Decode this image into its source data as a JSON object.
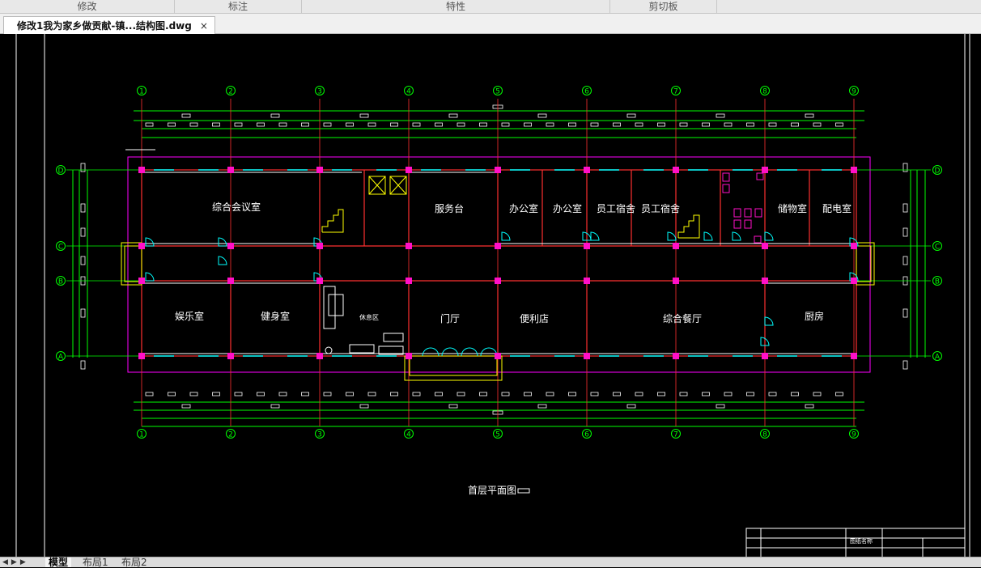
{
  "ribbon": {
    "groups": [
      "修改",
      "标注",
      "特性",
      "剪切板"
    ]
  },
  "document": {
    "tab_title": "修改1我为家乡做贡献-镇...结构图.dwg",
    "close_glyph": "×"
  },
  "drawing": {
    "grid_top": [
      "1",
      "2",
      "3",
      "4",
      "5",
      "6",
      "7",
      "8",
      "9"
    ],
    "grid_side": [
      "D",
      "C",
      "B",
      "A"
    ],
    "rooms": {
      "conference": "综合会议室",
      "service": "服务台",
      "office1": "办公室",
      "office2": "办公室",
      "staff1": "员工宿舍",
      "staff2": "员工宿舍",
      "storage": "储物室",
      "power": "配电室",
      "entertainment": "娱乐室",
      "gym": "健身室",
      "lounge": "休息区",
      "hall": "门厅",
      "store": "便利店",
      "dining": "综合餐厅",
      "kitchen": "厨房"
    },
    "plan_title": "首层平面图",
    "titleblock_text": "图纸名称"
  },
  "layout_tabs": {
    "model": "模型",
    "layout1": "布局1",
    "layout2": "布局2"
  },
  "colors": {
    "wall": "#ff3030",
    "axis": "#00ff00",
    "column": "#ff10c8",
    "window": "#00ffff",
    "text": "#ffffff",
    "stair": "#ffff00",
    "boundary": "#ff00ff"
  }
}
